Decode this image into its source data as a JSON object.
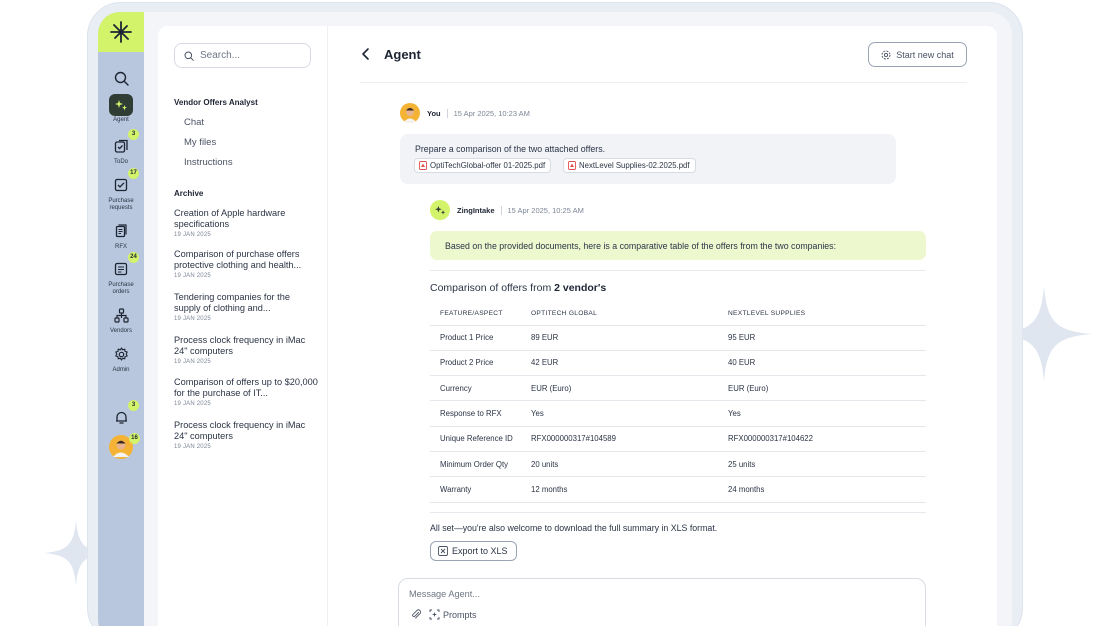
{
  "sidebar": {
    "search_placeholder": "Search...",
    "section_title": "Vendor Offers Analyst",
    "links": [
      "Chat",
      "My files",
      "Instructions"
    ],
    "archive_title": "Archive",
    "archive": [
      {
        "title": "Creation of Apple hardware specifications",
        "date": "19 JAN 2025"
      },
      {
        "title": "Comparison of purchase offers protective clothing and health...",
        "date": "19 JAN 2025"
      },
      {
        "title": "Tendering companies for the supply of clothing and...",
        "date": "19 JAN 2025"
      },
      {
        "title": "Process clock frequency in iMac 24\" computers",
        "date": "19 JAN 2025"
      },
      {
        "title": "Comparison of offers up to $20,000 for the purchase of IT...",
        "date": "19 JAN 2025"
      },
      {
        "title": "Process clock frequency in iMac 24\" computers",
        "date": "19 JAN 2025"
      }
    ]
  },
  "rail": {
    "agent_label": "Agent",
    "todo_label": "ToDo",
    "todo_badge": "3",
    "pr_label": "Purchase requests",
    "pr_badge": "17",
    "rfx_label": "RFX",
    "po_label": "Purchase orders",
    "po_badge": "24",
    "vendors_label": "Vendors",
    "admin_label": "Admin",
    "notif_badge": "3",
    "avatar_badge": "16"
  },
  "header": {
    "title": "Agent",
    "new_chat_label": "Start new chat"
  },
  "chat": {
    "user_name": "You",
    "user_time": "15 Apr 2025, 10:23 AM",
    "user_message": "Prepare a comparison of the two attached offers.",
    "attachments": [
      "OptiTechGlobal-offer 01-2025.pdf",
      "NextLevel Supplies-02.2025.pdf"
    ],
    "bot_name": "ZingIntake",
    "bot_time": "15 Apr 2025, 10:25 AM",
    "bot_intro": "Based on the provided documents, here is a comparative table of the offers from the two companies:",
    "comparison_title_prefix": "Comparison of offers from",
    "comparison_title_bold": "2 vendor's",
    "table": {
      "headers": [
        "FEATURE/ASPECT",
        "OPTITECH GLOBAL",
        "NEXTLEVEL SUPPLIES"
      ],
      "rows": [
        [
          "Product 1 Price",
          "89 EUR",
          "95 EUR"
        ],
        [
          "Product 2 Price",
          "42 EUR",
          "40 EUR"
        ],
        [
          "Currency",
          "EUR (Euro)",
          "EUR (Euro)"
        ],
        [
          "Response to RFX",
          "Yes",
          "Yes"
        ],
        [
          "Unique Reference ID",
          "RFX000000317#104589",
          "RFX000000317#104622"
        ],
        [
          "Minimum Order Qty",
          "20 units",
          "25 units"
        ],
        [
          "Warranty",
          "12 months",
          "24 months"
        ]
      ]
    },
    "closing": "All set—you're also welcome to download the full summary in XLS format.",
    "export_label": "Export to XLS"
  },
  "composer": {
    "placeholder": "Message Agent...",
    "prompts_label": "Prompts"
  },
  "colors": {
    "accent": "#d3f36b",
    "rail": "#b8c7dd",
    "sparkle": "#dfe6f0"
  }
}
